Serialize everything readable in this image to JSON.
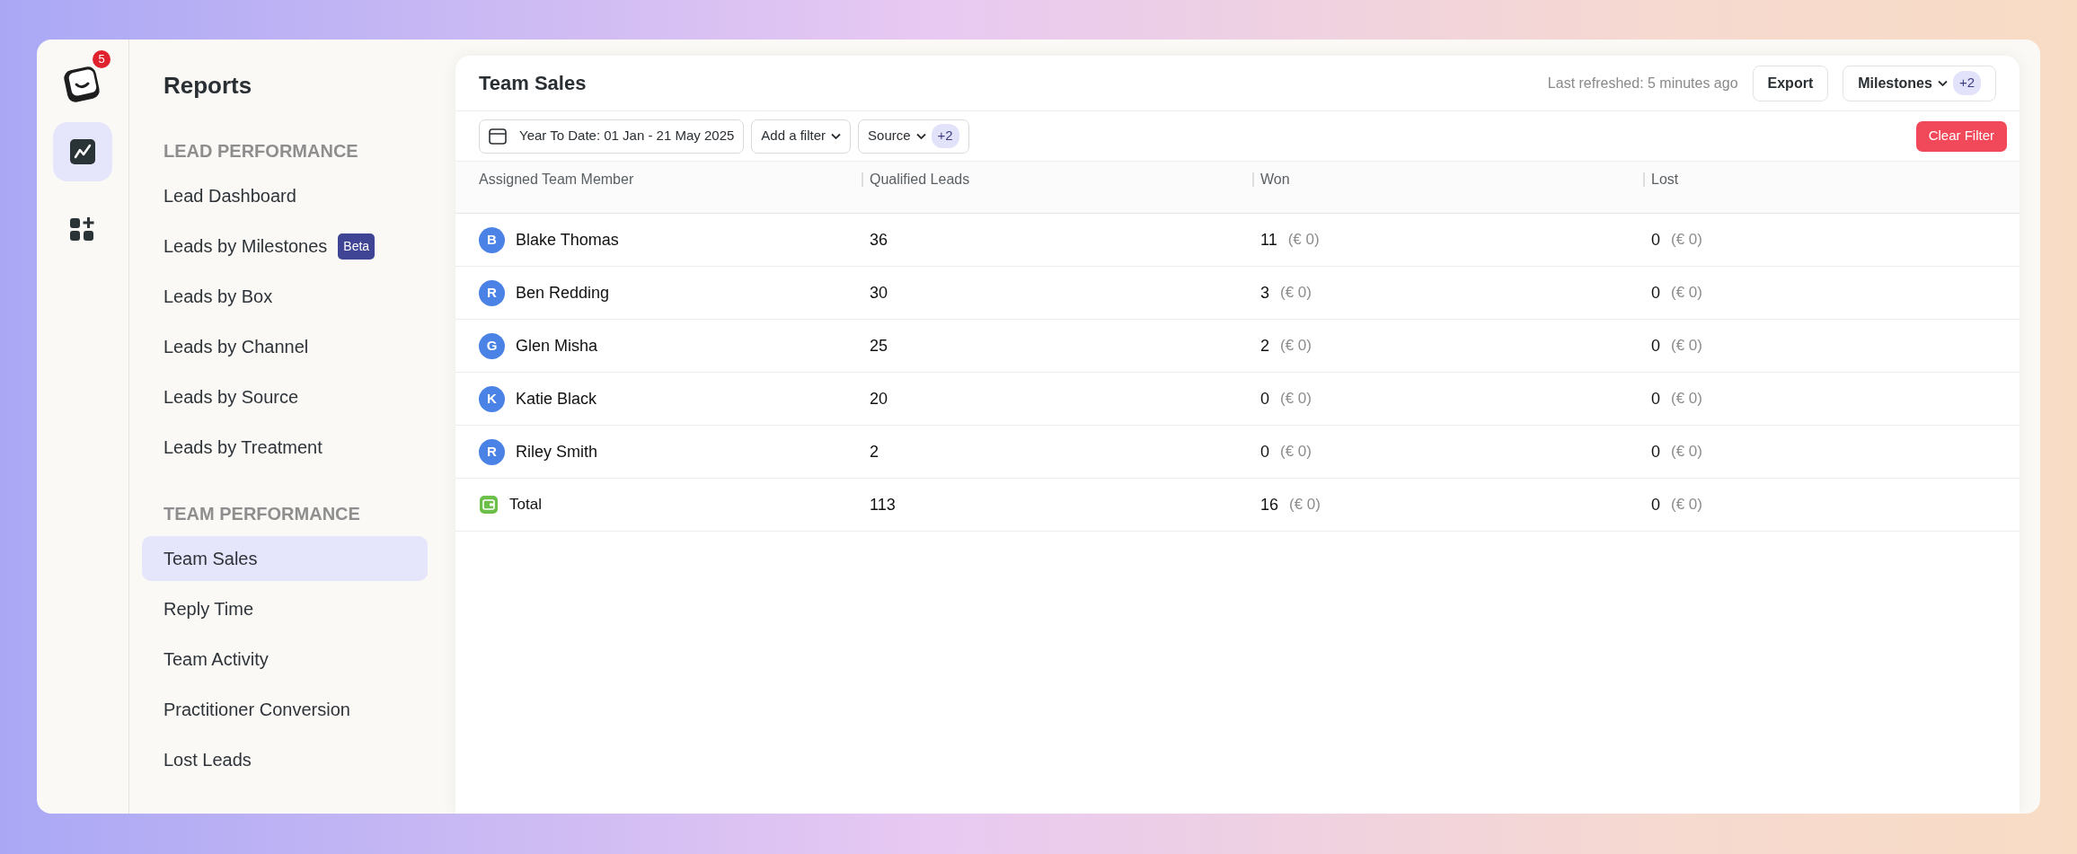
{
  "rail": {
    "logo_badge": "5",
    "items": [
      {
        "kind": "chart",
        "selected": true
      },
      {
        "kind": "apps",
        "selected": false
      }
    ]
  },
  "sidebar": {
    "title": "Reports",
    "sections": [
      {
        "heading": "LEAD PERFORMANCE",
        "items": [
          {
            "label": "Lead Dashboard",
            "selected": false
          },
          {
            "label": "Leads by Milestones",
            "selected": false,
            "badge": "Beta"
          },
          {
            "label": "Leads by Box",
            "selected": false
          },
          {
            "label": "Leads by Channel",
            "selected": false
          },
          {
            "label": "Leads by Source",
            "selected": false
          },
          {
            "label": "Leads by Treatment",
            "selected": false
          }
        ]
      },
      {
        "heading": "TEAM PERFORMANCE",
        "items": [
          {
            "label": "Team Sales",
            "selected": true
          },
          {
            "label": "Reply Time",
            "selected": false
          },
          {
            "label": "Team Activity",
            "selected": false
          },
          {
            "label": "Practitioner Conversion",
            "selected": false
          },
          {
            "label": "Lost Leads",
            "selected": false
          }
        ]
      }
    ]
  },
  "main": {
    "title": "Team Sales",
    "last_refreshed": "Last refreshed: 5 minutes ago",
    "export": "Export",
    "milestones": {
      "label": "Milestones",
      "count": "+2"
    },
    "filters": {
      "date": "Year To Date: 01 Jan - 21 May 2025",
      "add_filter": "Add a filter",
      "source": {
        "label": "Source",
        "count": "+2"
      },
      "clear": "Clear Filter"
    },
    "table": {
      "columns": [
        "Assigned Team Member",
        "Qualified Leads",
        "Won",
        "Lost"
      ],
      "rows": [
        {
          "initial": "B",
          "name": "Blake Thomas",
          "qualified": "36",
          "won": "11",
          "won_value": "(€ 0)",
          "lost": "0",
          "lost_value": "(€ 0)"
        },
        {
          "initial": "R",
          "name": "Ben Redding",
          "qualified": "30",
          "won": "3",
          "won_value": "(€ 0)",
          "lost": "0",
          "lost_value": "(€ 0)"
        },
        {
          "initial": "G",
          "name": "Glen Misha",
          "qualified": "25",
          "won": "2",
          "won_value": "(€ 0)",
          "lost": "0",
          "lost_value": "(€ 0)"
        },
        {
          "initial": "K",
          "name": "Katie Black",
          "qualified": "20",
          "won": "0",
          "won_value": "(€ 0)",
          "lost": "0",
          "lost_value": "(€ 0)"
        },
        {
          "initial": "R",
          "name": "Riley Smith",
          "qualified": "2",
          "won": "0",
          "won_value": "(€ 0)",
          "lost": "0",
          "lost_value": "(€ 0)"
        }
      ],
      "total": {
        "label": "Total",
        "qualified": "113",
        "won": "16",
        "won_value": "(€ 0)",
        "lost": "0",
        "lost_value": "(€ 0)"
      }
    }
  }
}
